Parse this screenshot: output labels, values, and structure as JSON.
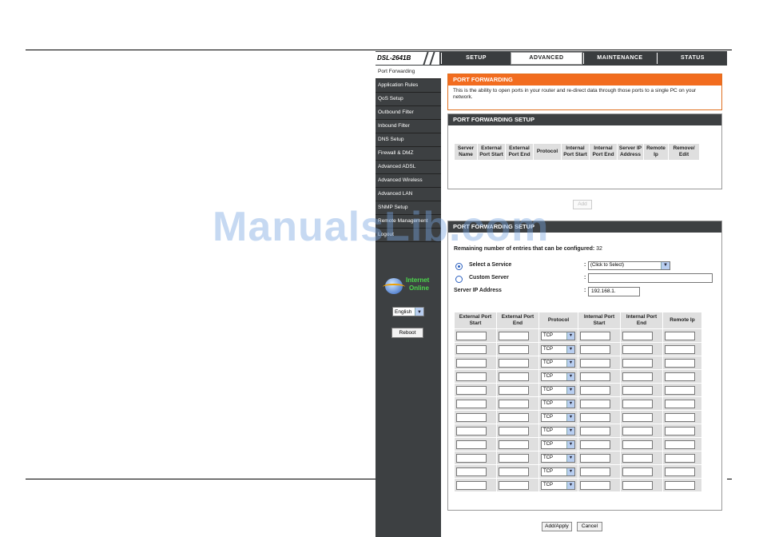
{
  "brand": "DSL-2641B",
  "tabs": [
    {
      "label": "SETUP",
      "active": false
    },
    {
      "label": "ADVANCED",
      "active": true
    },
    {
      "label": "MAINTENANCE",
      "active": false
    },
    {
      "label": "STATUS",
      "active": false
    }
  ],
  "sidebar": {
    "items": [
      {
        "label": "Port Forwarding",
        "active": true
      },
      {
        "label": "Application Rules",
        "active": false
      },
      {
        "label": "QoS Setup",
        "active": false
      },
      {
        "label": "Outbound Filter",
        "active": false
      },
      {
        "label": "Inbound Filter",
        "active": false
      },
      {
        "label": "DNS Setup",
        "active": false
      },
      {
        "label": "Firewall & DMZ",
        "active": false
      },
      {
        "label": "Advanced ADSL",
        "active": false
      },
      {
        "label": "Advanced Wireless",
        "active": false
      },
      {
        "label": "Advanced LAN",
        "active": false
      },
      {
        "label": "SNMP Setup",
        "active": false
      },
      {
        "label": "Remote Management",
        "active": false
      },
      {
        "label": "Logout",
        "active": false
      }
    ],
    "internet_status": [
      "Internet",
      "Online"
    ],
    "language": "English",
    "reboot_label": "Reboot"
  },
  "port_forwarding": {
    "title": "PORT FORWARDING",
    "description": "This is the ability to open ports in your router and re-direct data through those ports to a single PC on your network."
  },
  "setup_section": {
    "title": "PORT FORWARDING SETUP",
    "columns": [
      "Server Name",
      "External Port Start",
      "External Port End",
      "Protocol",
      "Internal Port Start",
      "Internal Port End",
      "Server IP Address",
      "Remote Ip",
      "Remove/ Edit"
    ],
    "add_label": "Add"
  },
  "add_section": {
    "title": "PORT FORWARDING SETUP",
    "remaining_label": "Remaining number of entries that can be configured:",
    "remaining_count": "32",
    "select_service_label": "Select a Service",
    "select_service_value": "(Click to Select)",
    "custom_server_label": "Custom Server",
    "custom_server_value": "",
    "server_ip_label": "Server IP Address",
    "server_ip_value": "192.168.1.",
    "colon": ":",
    "columns": [
      "External Port Start",
      "External Port End",
      "Protocol",
      "Internal Port Start",
      "Internal Port End",
      "Remote Ip"
    ],
    "protocol_default": "TCP",
    "row_count": 12
  },
  "buttons": {
    "apply": "Add/Apply",
    "cancel": "Cancel"
  },
  "watermark": "ManualsLib.com",
  "colors": {
    "accent_orange": "#f26c1f",
    "nav_dark": "#3d4042",
    "status_green": "#4cd64c"
  }
}
